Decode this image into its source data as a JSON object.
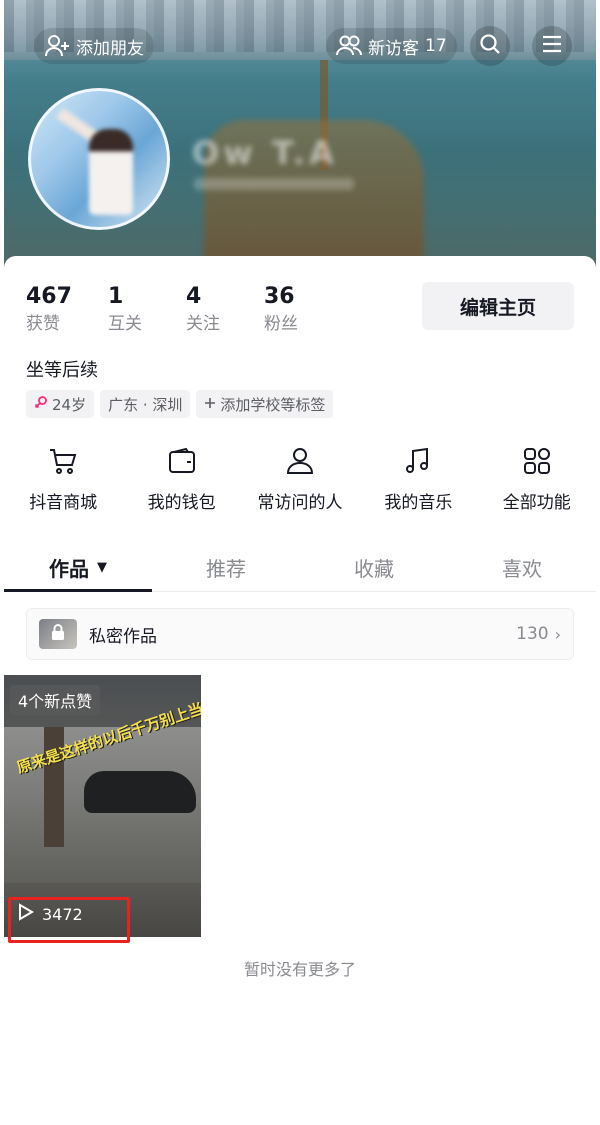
{
  "header": {
    "add_friend": "添加朋友",
    "visitors_label": "新访客",
    "visitors_count": "17",
    "nickname_blurred": "Ow T.A"
  },
  "stats": [
    {
      "value": "467",
      "label": "获赞"
    },
    {
      "value": "1",
      "label": "互关"
    },
    {
      "value": "4",
      "label": "关注"
    },
    {
      "value": "36",
      "label": "粉丝"
    }
  ],
  "edit_profile": "编辑主页",
  "bio": "坐等后续",
  "tags": {
    "age": "24岁",
    "location": "广东 · 深圳",
    "add_school": "添加学校等标签"
  },
  "shortcuts": [
    {
      "label": "抖音商城",
      "icon": "cart-icon"
    },
    {
      "label": "我的钱包",
      "icon": "wallet-icon"
    },
    {
      "label": "常访问的人",
      "icon": "person-icon"
    },
    {
      "label": "我的音乐",
      "icon": "music-note-icon"
    },
    {
      "label": "全部功能",
      "icon": "grid-icon"
    }
  ],
  "tabs": [
    {
      "label": "作品",
      "active": true
    },
    {
      "label": "推荐",
      "active": false
    },
    {
      "label": "收藏",
      "active": false
    },
    {
      "label": "喜欢",
      "active": false
    }
  ],
  "private_works": {
    "label": "私密作品",
    "count": "130"
  },
  "video": {
    "new_likes": "4个新点赞",
    "caption": "原来是这样的以后千万别上当了",
    "plays": "3472"
  },
  "footer_text": "暂时没有更多了",
  "colors": {
    "accent_red": "#e8231f",
    "female_pink": "#fe2c78",
    "text_primary": "#161823",
    "text_secondary": "#8a8b91"
  }
}
